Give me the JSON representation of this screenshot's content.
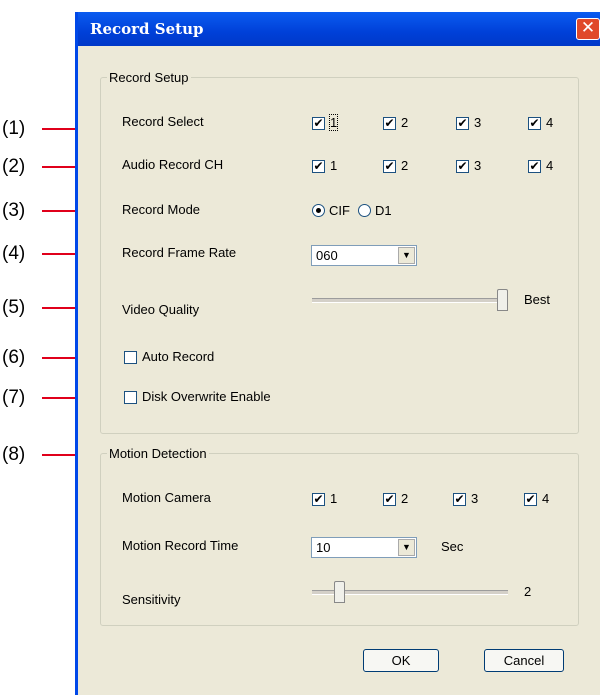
{
  "window": {
    "title": "Record Setup",
    "close_symbol": "✕"
  },
  "callouts": [
    "(1)",
    "(2)",
    "(3)",
    "(4)",
    "(5)",
    "(6)",
    "(7)",
    "(8)"
  ],
  "record_setup": {
    "legend": "Record Setup",
    "record_select": {
      "label": "Record Select",
      "channels": [
        "1",
        "2",
        "3",
        "4"
      ],
      "checked": [
        true,
        true,
        true,
        true
      ]
    },
    "audio_record": {
      "label": "Audio Record CH",
      "channels": [
        "1",
        "2",
        "3",
        "4"
      ],
      "checked": [
        true,
        true,
        true,
        true
      ]
    },
    "record_mode": {
      "label": "Record Mode",
      "options": [
        "CIF",
        "D1"
      ],
      "selected": "CIF"
    },
    "frame_rate": {
      "label": "Record Frame Rate",
      "value": "060"
    },
    "video_quality": {
      "label": "Video Quality",
      "value_label": "Best",
      "level": 1.0
    },
    "auto_record": {
      "label": "Auto Record",
      "checked": false
    },
    "disk_overwrite": {
      "label": "Disk Overwrite Enable",
      "checked": false
    }
  },
  "motion_detection": {
    "legend": "Motion Detection",
    "camera": {
      "label": "Motion Camera",
      "channels": [
        "1",
        "2",
        "3",
        "4"
      ],
      "checked": [
        true,
        true,
        true,
        true
      ]
    },
    "record_time": {
      "label": "Motion Record Time",
      "value": "10",
      "unit": "Sec"
    },
    "sensitivity": {
      "label": "Sensitivity",
      "value": "2"
    }
  },
  "buttons": {
    "ok": "OK",
    "cancel": "Cancel"
  },
  "check_mark": "✔",
  "dropdown_arrow": "▼"
}
